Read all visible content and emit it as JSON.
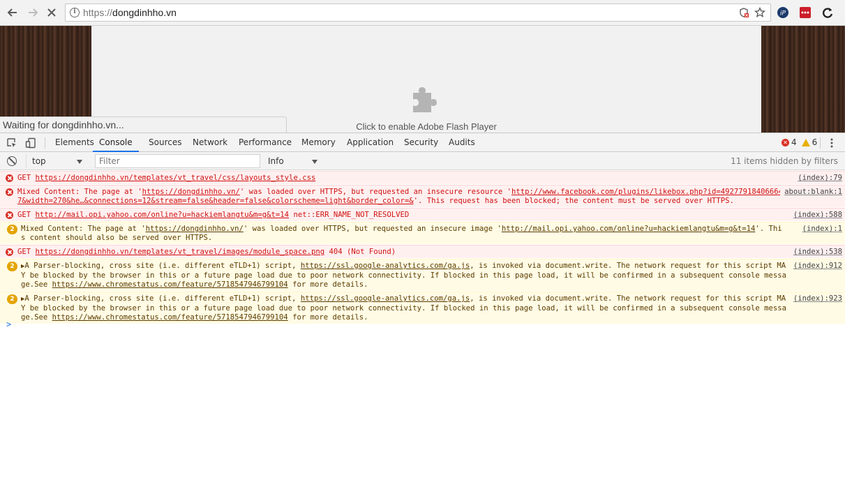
{
  "browser": {
    "url_scheme": "https://",
    "url_host": "dongdinhho.vn",
    "icons": [
      "back-arrow-icon",
      "forward-arrow-icon",
      "stop-icon",
      "info-icon",
      "blocked-content-icon",
      "bookmark-star-icon",
      "ipvanish-icon",
      "lastpass-icon",
      "refresh-extension-icon"
    ]
  },
  "page": {
    "flash_prompt": "Click to enable Adobe Flash Player",
    "status_text": "Waiting for dongdinhho.vn..."
  },
  "devtools": {
    "tabs": [
      "Elements",
      "Console",
      "Sources",
      "Network",
      "Performance",
      "Memory",
      "Application",
      "Security",
      "Audits"
    ],
    "active_tab": "Console",
    "error_count": "4",
    "warning_count": "6",
    "context": "top",
    "filter_placeholder": "Filter",
    "level": "Info",
    "hidden_text": "11 items hidden by filters"
  },
  "messages": [
    {
      "type": "error",
      "parts": [
        {
          "t": "GET "
        },
        {
          "t": "https://dongdinhho.vn/templates/vt_travel/css/layouts_style.css",
          "link": true
        }
      ],
      "source": "(index):79"
    },
    {
      "type": "error",
      "parts": [
        {
          "t": "Mixed Content: The page at '"
        },
        {
          "t": "https://dongdinhho.vn/",
          "link": true
        },
        {
          "t": "' was loaded over HTTPS, but requested an insecure resource '"
        },
        {
          "t": "http://www.facebook.com/plugins/likebox.php?id=492779184066647&width=270&he…&connections=12&stream=false&header=false&colorscheme=light&border_color=&",
          "link": true
        },
        {
          "t": "'. This request has been blocked; the content must be served over HTTPS."
        }
      ],
      "source": "about:blank:1"
    },
    {
      "type": "error",
      "parts": [
        {
          "t": "GET "
        },
        {
          "t": "http://mail.opi.yahoo.com/online?u=hackiemlangtu&m=g&t=14",
          "link": true
        },
        {
          "t": " net::ERR_NAME_NOT_RESOLVED"
        }
      ],
      "source": "(index):588"
    },
    {
      "type": "warning",
      "count": "2",
      "parts": [
        {
          "t": "Mixed Content: The page at '"
        },
        {
          "t": "https://dongdinhho.vn/",
          "link": true
        },
        {
          "t": "' was loaded over HTTPS, but requested an insecure image '"
        },
        {
          "t": "http://mail.opi.yahoo.com/online?u=hackiemlangtu&m=g&t=14",
          "link": true
        },
        {
          "t": "'. This content should also be served over HTTPS."
        }
      ],
      "source": "(index):1"
    },
    {
      "type": "error",
      "parts": [
        {
          "t": "GET "
        },
        {
          "t": "https://dongdinhho.vn/templates/vt_travel/images/module_space.png",
          "link": true
        },
        {
          "t": " 404 (Not Found)"
        }
      ],
      "source": "(index):538"
    },
    {
      "type": "warning",
      "count": "2",
      "parts": [
        {
          "t": "▶",
          "tri": true
        },
        {
          "t": "A Parser-blocking, cross site (i.e. different eTLD+1) script, "
        },
        {
          "t": "https://ssl.google-analytics.com/ga.js",
          "link": true
        },
        {
          "t": ", is invoked via document.write. The network request for this script MAY be blocked by the browser in this or a future page load due to poor network connectivity. If blocked in this page load, it will be confirmed in a subsequent console message.See "
        },
        {
          "t": "https://www.chromestatus.com/feature/5718547946799104",
          "link": true
        },
        {
          "t": " for more details."
        }
      ],
      "source": "(index):912"
    },
    {
      "type": "warning",
      "count": "2",
      "parts": [
        {
          "t": "▶",
          "tri": true
        },
        {
          "t": "A Parser-blocking, cross site (i.e. different eTLD+1) script, "
        },
        {
          "t": "https://ssl.google-analytics.com/ga.js",
          "link": true
        },
        {
          "t": ", is invoked via document.write. The network request for this script MAY be blocked by the browser in this or a future page load due to poor network connectivity. If blocked in this page load, it will be confirmed in a subsequent console message.See "
        },
        {
          "t": "https://www.chromestatus.com/feature/5718547946799104",
          "link": true
        },
        {
          "t": " for more details."
        }
      ],
      "source": "(index):923"
    }
  ],
  "prompt_symbol": ">"
}
